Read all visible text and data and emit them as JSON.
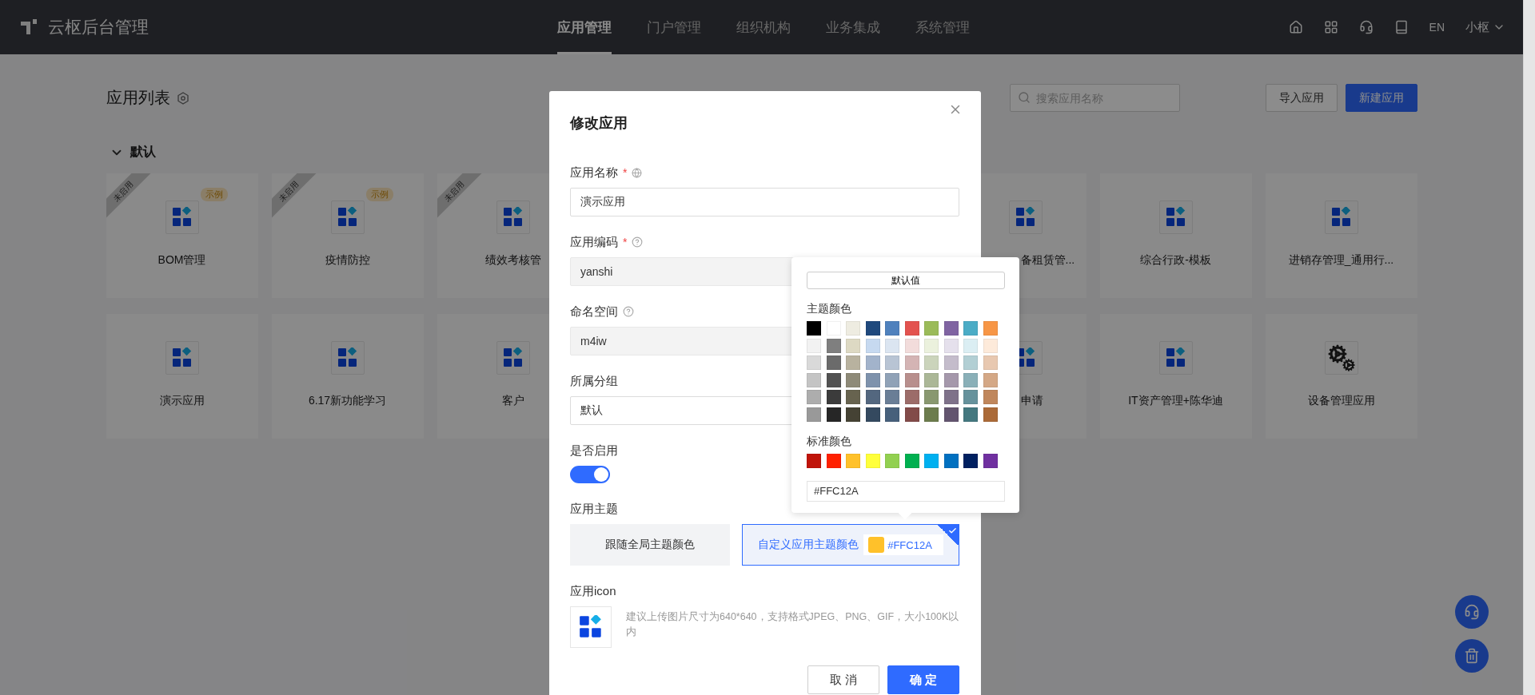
{
  "header": {
    "brand": "云枢后台管理",
    "nav": [
      {
        "label": "应用管理",
        "selected": true
      },
      {
        "label": "门户管理",
        "selected": false
      },
      {
        "label": "组织机构",
        "selected": false
      },
      {
        "label": "业务集成",
        "selected": false
      },
      {
        "label": "系统管理",
        "selected": false
      }
    ],
    "lang": "EN",
    "user": "小枢"
  },
  "toolbar": {
    "title": "应用列表",
    "search": {
      "placeholder": "搜索应用名称"
    },
    "buttons": [
      {
        "label": "导入应用",
        "kind": "secondary"
      },
      {
        "label": "新建应用",
        "kind": "primary"
      }
    ]
  },
  "group": {
    "title": "默认",
    "expanded": true,
    "rows": [
      {
        "left": [
          {
            "name": "BOM管理",
            "ribbon": "未启用",
            "badge": "示例",
            "kind": "blocks"
          },
          {
            "name": "疫情防控",
            "ribbon": "未启用",
            "badge": "示例",
            "kind": "blocks"
          },
          {
            "name": "绩效考核管",
            "ribbon": "未启用",
            "kind": "blocks"
          }
        ],
        "right": [
          {
            "name": "备租赁管...",
            "kind": "blocks"
          },
          {
            "name": "综合行政-模板",
            "kind": "blocks"
          },
          {
            "name": "进销存管理_通用行...",
            "kind": "blocks"
          }
        ]
      },
      {
        "left": [
          {
            "name": "演示应用",
            "kind": "blocks"
          },
          {
            "name": "6.17新功能学习",
            "kind": "blocks"
          },
          {
            "name": "客户",
            "kind": "blocks"
          }
        ],
        "right": [
          {
            "name": "申请",
            "kind": "blocks"
          },
          {
            "name": "IT资产管理+陈华迪",
            "kind": "blocks"
          },
          {
            "name": "设备管理应用",
            "kind": "gears"
          }
        ]
      }
    ]
  },
  "modal": {
    "title": "修改应用",
    "fields": [
      {
        "kind": "input",
        "label": "应用名称",
        "required_mark": "*",
        "help": true,
        "value": "演示应用",
        "disabled": false
      },
      {
        "kind": "input",
        "label": "应用编码",
        "required_mark": "*",
        "help": true,
        "value": "yanshi",
        "disabled": true
      },
      {
        "kind": "input",
        "label": "命名空间",
        "help": true,
        "value": "m4iw",
        "disabled": true
      },
      {
        "kind": "select",
        "label": "所属分组",
        "value": "默认"
      },
      {
        "kind": "switch",
        "label": "是否启用",
        "on": true
      },
      {
        "kind": "theme",
        "label": "应用主题",
        "options": [
          {
            "kind": "global",
            "label": "跟随全局主题颜色",
            "selected": false
          },
          {
            "kind": "custom",
            "label": "自定义应用主题颜色",
            "selected": true,
            "value": "#FFC12A",
            "color": "#ffc12a"
          }
        ]
      },
      {
        "kind": "icon",
        "label": "应用icon",
        "hint": "建议上传图片尺寸为640*640，支持格式JPEG、PNG、GIF，大小100K以内"
      }
    ],
    "buttons": [
      {
        "label": "取 消",
        "kind": "secondary"
      },
      {
        "label": "确 定",
        "kind": "primary"
      }
    ]
  },
  "color_picker": {
    "default_button": "默认值",
    "theme_title": "主题颜色",
    "theme_colors": [
      {
        "color": "#000000"
      },
      {
        "color": "#ffffff"
      },
      {
        "color": "#eeece1"
      },
      {
        "color": "#1f497d"
      },
      {
        "color": "#4f81bd"
      },
      {
        "color": "#e3534f"
      },
      {
        "color": "#9bbb59"
      },
      {
        "color": "#8064a2"
      },
      {
        "color": "#4bacc6"
      },
      {
        "color": "#f79646"
      },
      {
        "color": "#f2f2f2"
      },
      {
        "color": "#7f7f7f"
      },
      {
        "color": "#ddd9c3"
      },
      {
        "color": "#c6d9f0"
      },
      {
        "color": "#dbe5f1"
      },
      {
        "color": "#f2dcdb"
      },
      {
        "color": "#ebf1dd"
      },
      {
        "color": "#e5e0ec"
      },
      {
        "color": "#dbeef3"
      },
      {
        "color": "#fdeada"
      },
      {
        "color": "#d9d9d9"
      },
      {
        "color": "#6b6b6b"
      },
      {
        "color": "#b8b29f"
      },
      {
        "color": "#a2b3cb"
      },
      {
        "color": "#b8c4d4"
      },
      {
        "color": "#d4b4b4"
      },
      {
        "color": "#cbd4bb"
      },
      {
        "color": "#c4bccb"
      },
      {
        "color": "#b2cfd4"
      },
      {
        "color": "#e8c8b0"
      },
      {
        "color": "#c4c4c4"
      },
      {
        "color": "#525252"
      },
      {
        "color": "#8e8a78"
      },
      {
        "color": "#7e92ac"
      },
      {
        "color": "#90a2b7"
      },
      {
        "color": "#b88f8d"
      },
      {
        "color": "#abb797"
      },
      {
        "color": "#a598ab"
      },
      {
        "color": "#8ab0b8"
      },
      {
        "color": "#d4a886"
      },
      {
        "color": "#adadad"
      },
      {
        "color": "#3b3b3b"
      },
      {
        "color": "#67634f"
      },
      {
        "color": "#53677f"
      },
      {
        "color": "#6a7e96"
      },
      {
        "color": "#9c6c69"
      },
      {
        "color": "#899870"
      },
      {
        "color": "#7f728a"
      },
      {
        "color": "#66929c"
      },
      {
        "color": "#c0875c"
      },
      {
        "color": "#999999"
      },
      {
        "color": "#262626"
      },
      {
        "color": "#454234"
      },
      {
        "color": "#34495f"
      },
      {
        "color": "#47607b"
      },
      {
        "color": "#824b49"
      },
      {
        "color": "#6c7c4d"
      },
      {
        "color": "#63556f"
      },
      {
        "color": "#44787f"
      },
      {
        "color": "#ab6a38"
      }
    ],
    "standard_title": "标准颜色",
    "standard_colors": [
      {
        "color": "#c0140a"
      },
      {
        "color": "#ff2000"
      },
      {
        "color": "#ffc12a"
      },
      {
        "color": "#ffff3a"
      },
      {
        "color": "#92d050"
      },
      {
        "color": "#00b050"
      },
      {
        "color": "#00b0f0"
      },
      {
        "color": "#0070c0"
      },
      {
        "color": "#002060"
      },
      {
        "color": "#7030a0"
      }
    ],
    "value": "#FFC12A"
  }
}
